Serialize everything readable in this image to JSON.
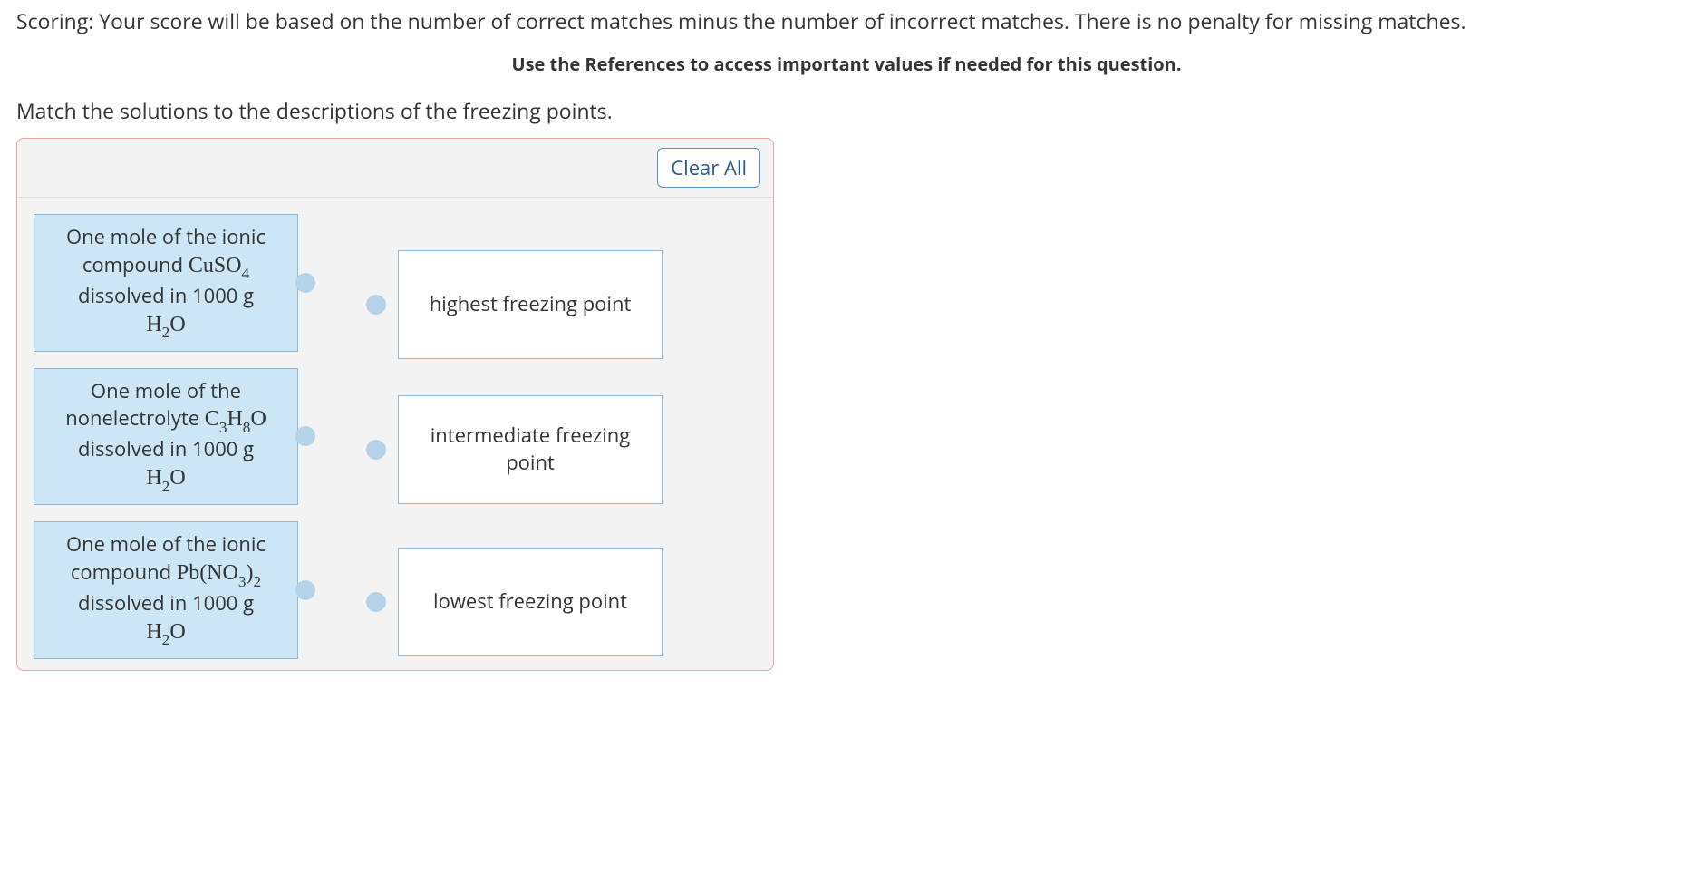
{
  "scoring": "Scoring: Your score will be based on the number of correct matches minus the number of incorrect matches. There is no penalty for missing matches.",
  "references": "Use the References to access important values if needed for this question.",
  "instruction": "Match the solutions to the descriptions of the freezing points.",
  "clear_all": "Clear All",
  "left_items": [
    {
      "line1": "One mole of the ionic",
      "line2a": "compound ",
      "formula1": "CuSO",
      "sub1": "4",
      "line3": "dissolved in 1000 g",
      "formula2": "H",
      "sub2a": "2",
      "formula2b": "O"
    },
    {
      "line1": "One mole of the",
      "line2a": "nonelectrolyte ",
      "formula1": "C",
      "sub1a": "3",
      "formula1b": "H",
      "sub1c": "8",
      "formula1d": "O",
      "line3": "dissolved in 1000 g",
      "formula2": "H",
      "sub2a": "2",
      "formula2b": "O"
    },
    {
      "line1": "One mole of the ionic",
      "line2a": "compound ",
      "formula1": "Pb(NO",
      "sub1": "3",
      "formula1b": ")",
      "sub1c": "2",
      "line3": "dissolved in 1000 g",
      "formula2": "H",
      "sub2a": "2",
      "formula2b": "O"
    }
  ],
  "right_items": [
    "highest freezing point",
    "intermediate freezing point",
    "lowest freezing point"
  ]
}
